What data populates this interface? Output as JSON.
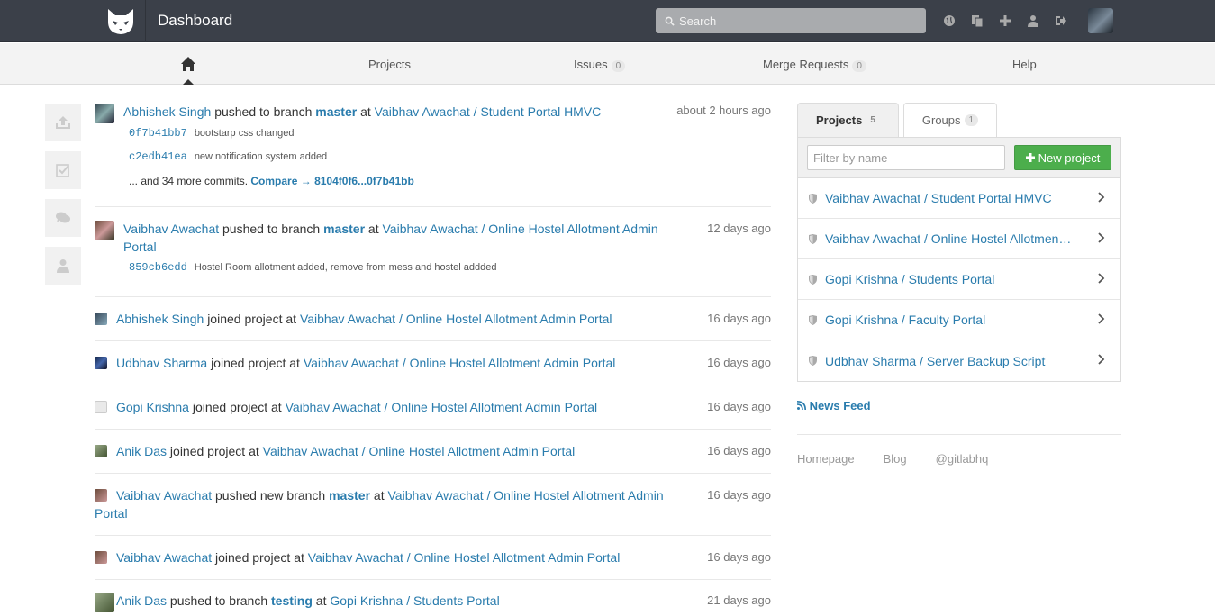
{
  "topbar": {
    "title": "Dashboard",
    "search_placeholder": "Search",
    "icons": [
      "globe-icon",
      "copy-icon",
      "plus-icon",
      "user-icon",
      "sign-out-icon"
    ]
  },
  "nav": {
    "projects": "Projects",
    "issues": "Issues",
    "issues_count": "0",
    "merge_requests": "Merge Requests",
    "merge_requests_count": "0",
    "help": "Help"
  },
  "feed": [
    {
      "author": "Abhishek Singh",
      "action": "pushed to branch",
      "branch": "master",
      "at": "at",
      "project": "Vaibhav Awachat / Student Portal HMVC",
      "time": "about 2 hours ago",
      "commits": [
        {
          "sha": "0f7b41bb7",
          "msg": "bootstarp css changed"
        },
        {
          "sha": "c2edb41ea",
          "msg": "new notification system added"
        }
      ],
      "more_text": "... and 34 more commits.",
      "compare_text": "Compare → 8104f0f6...0f7b41bb"
    },
    {
      "author": "Vaibhav Awachat",
      "action": "pushed to branch",
      "branch": "master",
      "at": "at",
      "project": "Vaibhav Awachat / Online Hostel Allotment Admin Portal",
      "time": "12 days ago",
      "commits": [
        {
          "sha": "859cb6edd",
          "msg": "Hostel Room allotment added, remove from mess and hostel addded"
        }
      ]
    },
    {
      "author": "Abhishek Singh",
      "action": "joined project",
      "at": "at",
      "project": "Vaibhav Awachat / Online Hostel Allotment Admin Portal",
      "time": "16 days ago"
    },
    {
      "author": "Udbhav Sharma",
      "action": "joined project",
      "at": "at",
      "project": "Vaibhav Awachat / Online Hostel Allotment Admin Portal",
      "time": "16 days ago"
    },
    {
      "author": "Gopi Krishna",
      "action": "joined project",
      "at": "at",
      "project": "Vaibhav Awachat / Online Hostel Allotment Admin Portal",
      "time": "16 days ago"
    },
    {
      "author": "Anik Das",
      "action": "joined project",
      "at": "at",
      "project": "Vaibhav Awachat / Online Hostel Allotment Admin Portal",
      "time": "16 days ago"
    },
    {
      "author": "Vaibhav Awachat",
      "action": "pushed new branch",
      "branch": "master",
      "at": "at",
      "project": "Vaibhav Awachat / Online Hostel Allotment Admin Portal",
      "time": "16 days ago"
    },
    {
      "author": "Vaibhav Awachat",
      "action": "joined project",
      "at": "at",
      "project": "Vaibhav Awachat / Online Hostel Allotment Admin Portal",
      "time": "16 days ago"
    },
    {
      "author": "Anik Das",
      "action": "pushed to branch",
      "branch": "testing",
      "at": "at",
      "project": "Gopi Krishna / Students Portal",
      "time": "21 days ago"
    }
  ],
  "sidebar": {
    "tab_projects": "Projects",
    "tab_projects_count": "5",
    "tab_groups": "Groups",
    "tab_groups_count": "1",
    "filter_placeholder": "Filter by name",
    "new_project": "New project",
    "projects": [
      "Vaibhav Awachat / Student Portal HMVC",
      "Vaibhav Awachat / Online Hostel Allotment Admin Portal",
      "Gopi Krishna / Students Portal",
      "Gopi Krishna / Faculty Portal",
      "Udbhav Sharma / Server Backup Script"
    ],
    "news_feed": "News Feed",
    "footer": [
      "Homepage",
      "Blog",
      "@gitlabhq"
    ]
  }
}
